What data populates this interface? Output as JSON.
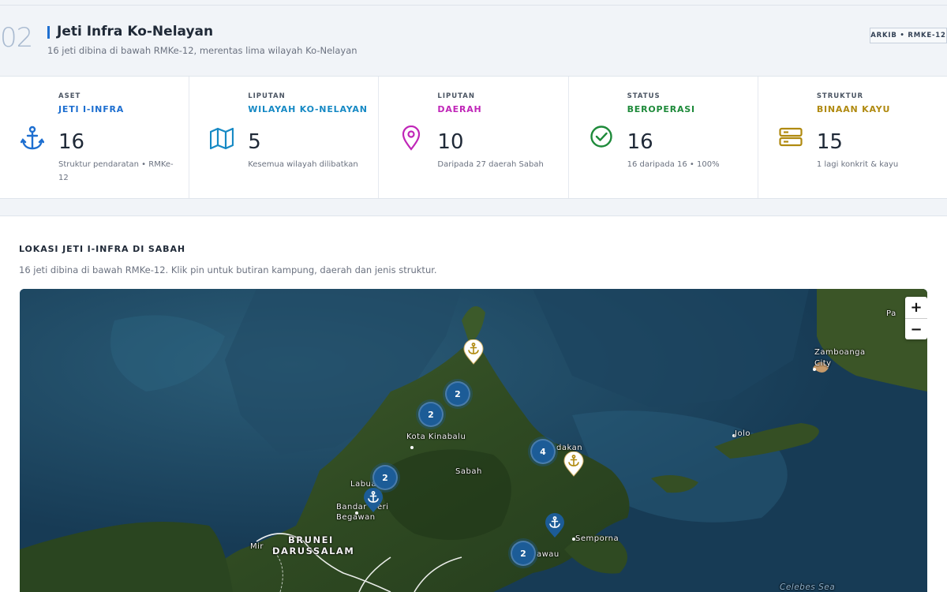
{
  "header": {
    "number": "02",
    "title": "Jeti Infra Ko-Nelayan",
    "subtitle": "16 jeti dibina di bawah RMKe-12, merentas lima wilayah Ko-Nelayan",
    "badge": "ARKIB • RMKE-12"
  },
  "stats": [
    {
      "kicker": "ASET",
      "label": "JETI I-INFRA",
      "value": "16",
      "desc": "Struktur pendaratan • RMKe-12",
      "icon": "anchor-icon",
      "color": "#1e6fd0"
    },
    {
      "kicker": "LIPUTAN",
      "label": "WILAYAH KO-NELAYAN",
      "value": "5",
      "desc": "Kesemua wilayah dilibatkan",
      "icon": "map-icon",
      "color": "#1689c4"
    },
    {
      "kicker": "LIPUTAN",
      "label": "DAERAH",
      "value": "10",
      "desc": "Daripada 27 daerah Sabah",
      "icon": "location-pin-icon",
      "color": "#c026b8"
    },
    {
      "kicker": "STATUS",
      "label": "BEROPERASI",
      "value": "16",
      "desc": "16 daripada 16 • 100%",
      "icon": "check-circle-icon",
      "color": "#1e8a3a"
    },
    {
      "kicker": "STRUKTUR",
      "label": "BINAAN KAYU",
      "value": "15",
      "desc": "1 lagi konkrit & kayu",
      "icon": "server-icon",
      "color": "#b08a10"
    }
  ],
  "map_section": {
    "heading": "LOKASI JETI I-INFRA DI SABAH",
    "caption": "16 jeti dibina di bawah RMKe-12. Klik pin untuk butiran kampung, daerah dan jenis struktur.",
    "zoom_in": "+",
    "zoom_out": "−",
    "places": {
      "kota_kinabalu": "Kota Kinabalu",
      "sabah": "Sabah",
      "labuan": "Labua",
      "bandar_1": "Bandar",
      "bandar_2": "eri",
      "begawan": "Begawan",
      "brunei": "BRUNEI",
      "darussalam": "DARUSSALAM",
      "miri": "Mir",
      "sandakan": "dakan",
      "semporna": "Semporna",
      "tawau": "awau",
      "zamboanga": "Zamboanga",
      "city": "City",
      "jolo": "Jolo",
      "pagadian": "Pa",
      "celebes": "Celebes Sea"
    },
    "clusters": [
      {
        "count": "2"
      },
      {
        "count": "2"
      },
      {
        "count": "4"
      },
      {
        "count": "2"
      },
      {
        "count": "2"
      }
    ]
  }
}
